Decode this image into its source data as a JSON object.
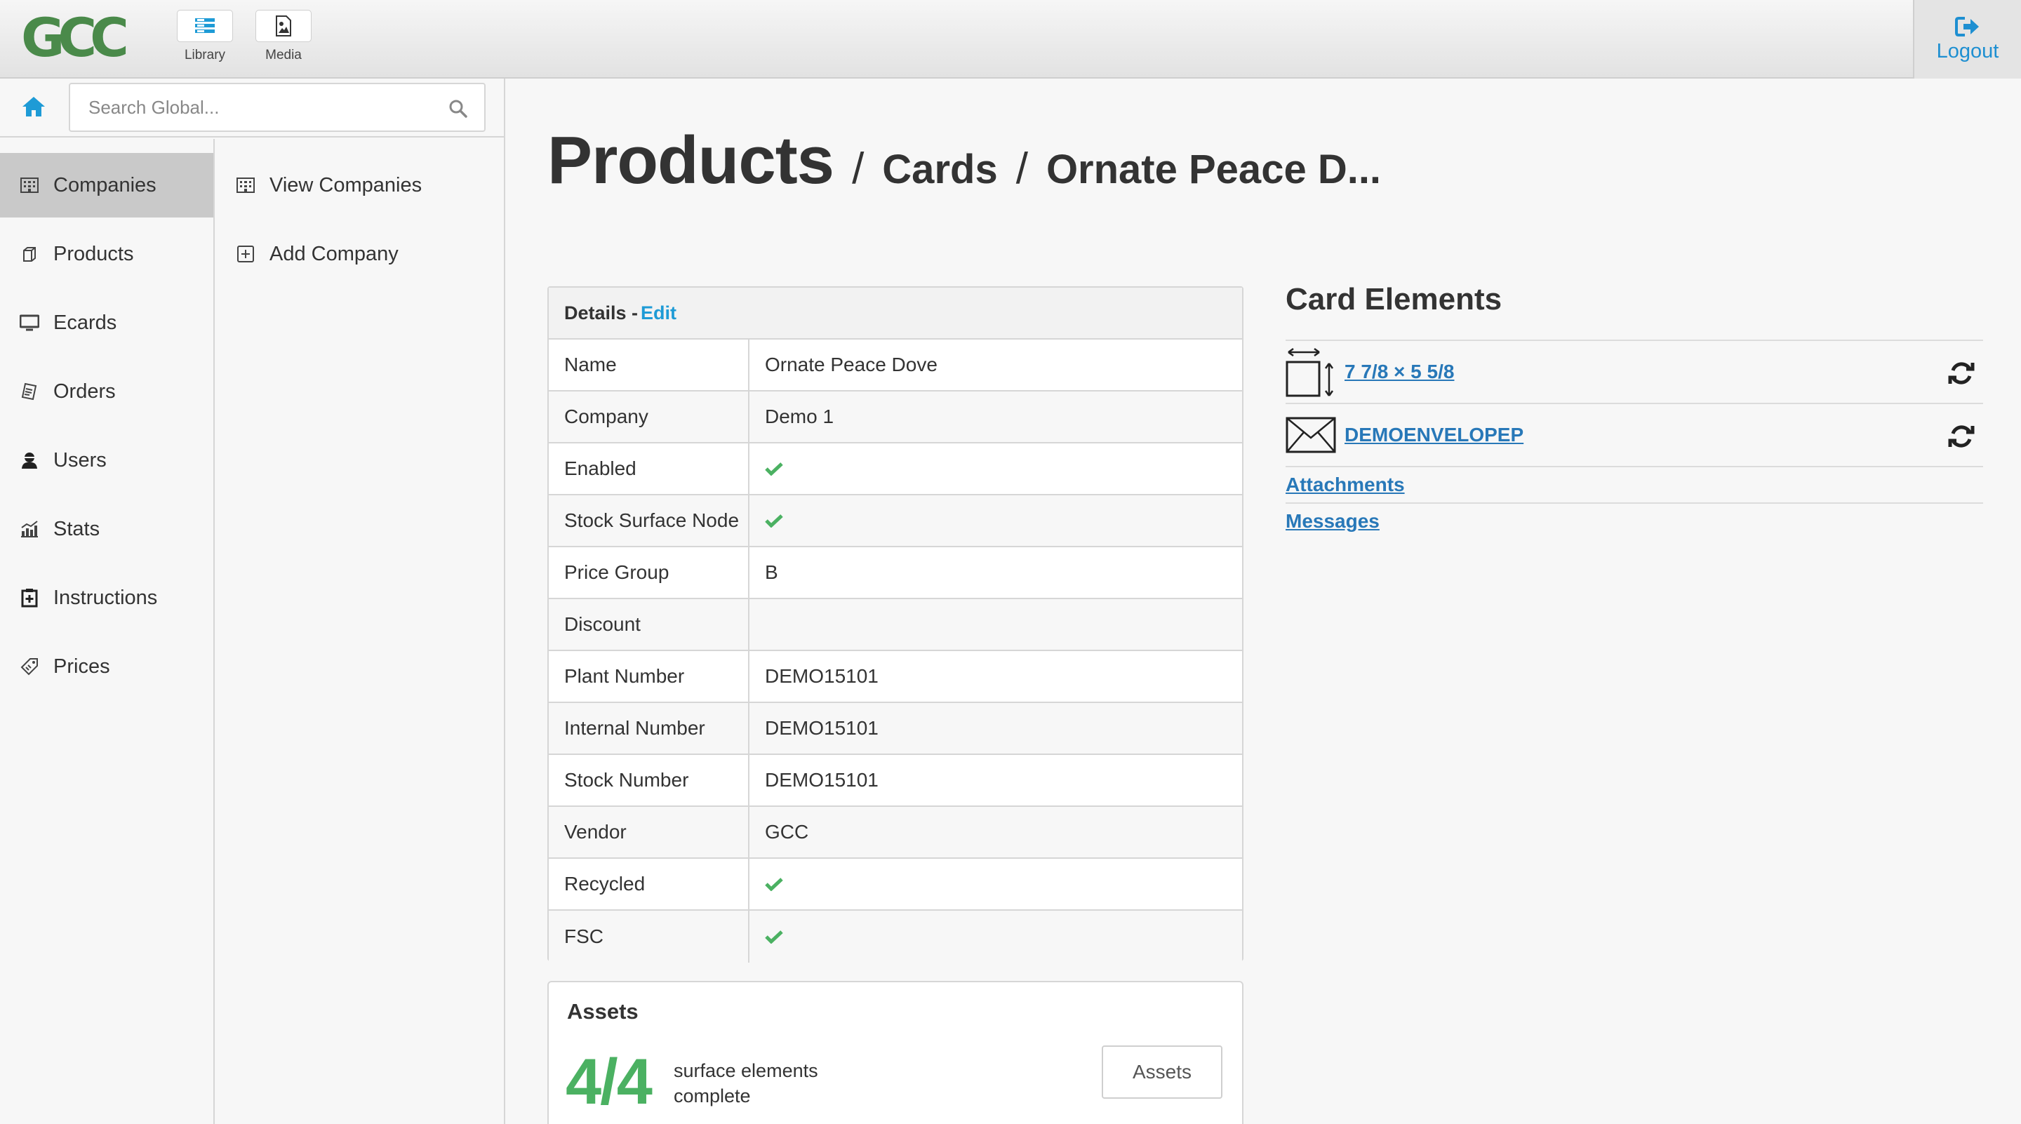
{
  "topbar": {
    "logo_text": "GCC",
    "library_label": "Library",
    "media_label": "Media",
    "logout_label": "Logout"
  },
  "search": {
    "placeholder": "Search Global..."
  },
  "nav_primary": [
    {
      "label": "Companies",
      "icon": "building-icon",
      "active": true
    },
    {
      "label": "Products",
      "icon": "box-icon"
    },
    {
      "label": "Ecards",
      "icon": "monitor-icon"
    },
    {
      "label": "Orders",
      "icon": "receipt-icon"
    },
    {
      "label": "Users",
      "icon": "user-icon"
    },
    {
      "label": "Stats",
      "icon": "bar-chart-icon"
    },
    {
      "label": "Instructions",
      "icon": "clipboard-plus-icon"
    },
    {
      "label": "Prices",
      "icon": "price-tag-icon"
    }
  ],
  "nav_secondary": [
    {
      "label": "View Companies",
      "icon": "building-icon"
    },
    {
      "label": "Add Company",
      "icon": "plus-square-icon"
    }
  ],
  "breadcrumb": {
    "root": "Products",
    "level1": "Cards",
    "level2": "Ornate Peace D..."
  },
  "details": {
    "title": "Details - ",
    "edit_label": "Edit",
    "rows": [
      {
        "label": "Name",
        "value": "Ornate Peace Dove"
      },
      {
        "label": "Company",
        "value": "Demo 1"
      },
      {
        "label": "Enabled",
        "value": "",
        "check": true
      },
      {
        "label": "Stock Surface Node",
        "value": "",
        "check": true
      },
      {
        "label": "Price Group",
        "value": "B"
      },
      {
        "label": "Discount",
        "value": ""
      },
      {
        "label": "Plant Number",
        "value": "DEMO15101"
      },
      {
        "label": "Internal Number",
        "value": "DEMO15101"
      },
      {
        "label": "Stock Number",
        "value": "DEMO15101"
      },
      {
        "label": "Vendor",
        "value": "GCC"
      },
      {
        "label": "Recycled",
        "value": "",
        "check": true
      },
      {
        "label": "FSC",
        "value": "",
        "check": true
      }
    ]
  },
  "assets": {
    "title": "Assets",
    "count": "4/4",
    "text_line1": "surface elements",
    "text_line2": "complete",
    "button_label": "Assets"
  },
  "card_elements": {
    "title": "Card Elements",
    "size_link": "7 7/8 × 5 5/8",
    "envelope_link": "DEMOENVELOPEP",
    "attachments_link": "Attachments",
    "messages_link": "Messages"
  },
  "colors": {
    "accent_blue": "#1e9bd6",
    "link_blue": "#2878b8",
    "check_green": "#4bb162",
    "logo_green": "#4a8a4a"
  }
}
